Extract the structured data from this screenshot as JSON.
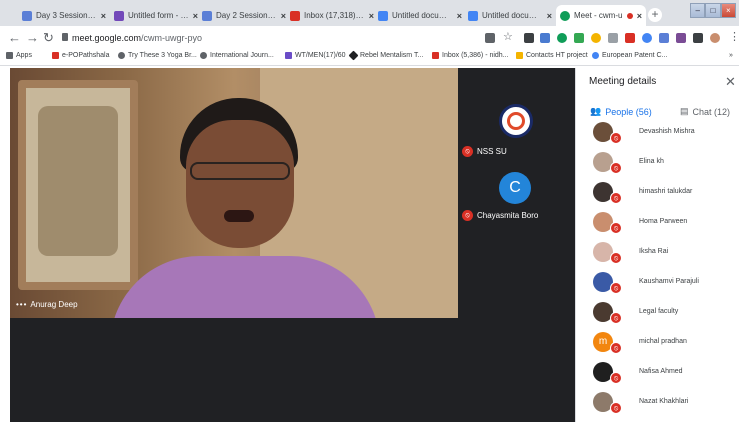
{
  "browser": {
    "tabs": [
      {
        "title": "Day 3 Session -1 -",
        "color": "#5b7fd6",
        "active": false
      },
      {
        "title": "Untitled form - Go",
        "color": "#7248b9",
        "active": false
      },
      {
        "title": "Day 2 Session -1 -",
        "color": "#5b7fd6",
        "active": false
      },
      {
        "title": "Inbox (17,318) - nu",
        "color": "#d93025",
        "active": false
      },
      {
        "title": "Untitled documen",
        "color": "#4285f4",
        "active": false
      },
      {
        "title": "Untitled documen",
        "color": "#4285f4",
        "active": false
      },
      {
        "title": "Meet - cwm-u",
        "color": "#0f9d58",
        "active": true
      }
    ],
    "close_glyph": "×",
    "new_tab_glyph": "+",
    "window_controls": [
      "–",
      "□",
      "×"
    ],
    "url_host": "meet.google.com",
    "url_path": "/cwm-uwgr-pyo"
  },
  "bookmarks": [
    {
      "label": "Apps",
      "color": "#5f6368"
    },
    {
      "label": "e-POPathshala",
      "color": "#d93025"
    },
    {
      "label": "Try These 3 Yoga Br...",
      "color": "#5f6368"
    },
    {
      "label": "International Journ...",
      "color": "#5f6368"
    },
    {
      "label": "WT/MEN(17)/60",
      "color": "#6a4cc7"
    },
    {
      "label": "Rebel Mentalism T...",
      "color": "#202124"
    },
    {
      "label": "Inbox (5,386) - nidh...",
      "color": "#d93025"
    },
    {
      "label": "Contacts HT project",
      "color": "#f4b400"
    },
    {
      "label": "European Patent C...",
      "color": "#4285f4"
    }
  ],
  "meet": {
    "main_speaker": "Anurag Deep",
    "tiles": [
      {
        "name": "NSS SU"
      },
      {
        "name": "Chayasmita Boro",
        "initial": "C"
      }
    ]
  },
  "panel": {
    "title": "Meeting details",
    "people_tab": "People (56)",
    "chat_tab": "Chat (12)",
    "participants": [
      {
        "name": "Devashish Mishra",
        "avatar_color": "#6b4f3a",
        "initial": ""
      },
      {
        "name": "Elina kh",
        "avatar_color": "#b8a08f",
        "initial": ""
      },
      {
        "name": "himashri talukdar",
        "avatar_color": "#3d3431",
        "initial": ""
      },
      {
        "name": "Homa Parween",
        "avatar_color": "#c98e6e",
        "initial": ""
      },
      {
        "name": "Iksha Rai",
        "avatar_color": "#d7b5a9",
        "initial": ""
      },
      {
        "name": "Kaushamvi Parajuli",
        "avatar_color": "#3a5aa6",
        "initial": ""
      },
      {
        "name": "Legal faculty",
        "avatar_color": "#4a3a30",
        "initial": ""
      },
      {
        "name": "michal pradhan",
        "avatar_color": "#f2860f",
        "initial": "m"
      },
      {
        "name": "Nafisa Ahmed",
        "avatar_color": "#1f1f1f",
        "initial": ""
      },
      {
        "name": "Nazat Khakhlari",
        "avatar_color": "#8d7a6a",
        "initial": ""
      }
    ]
  }
}
